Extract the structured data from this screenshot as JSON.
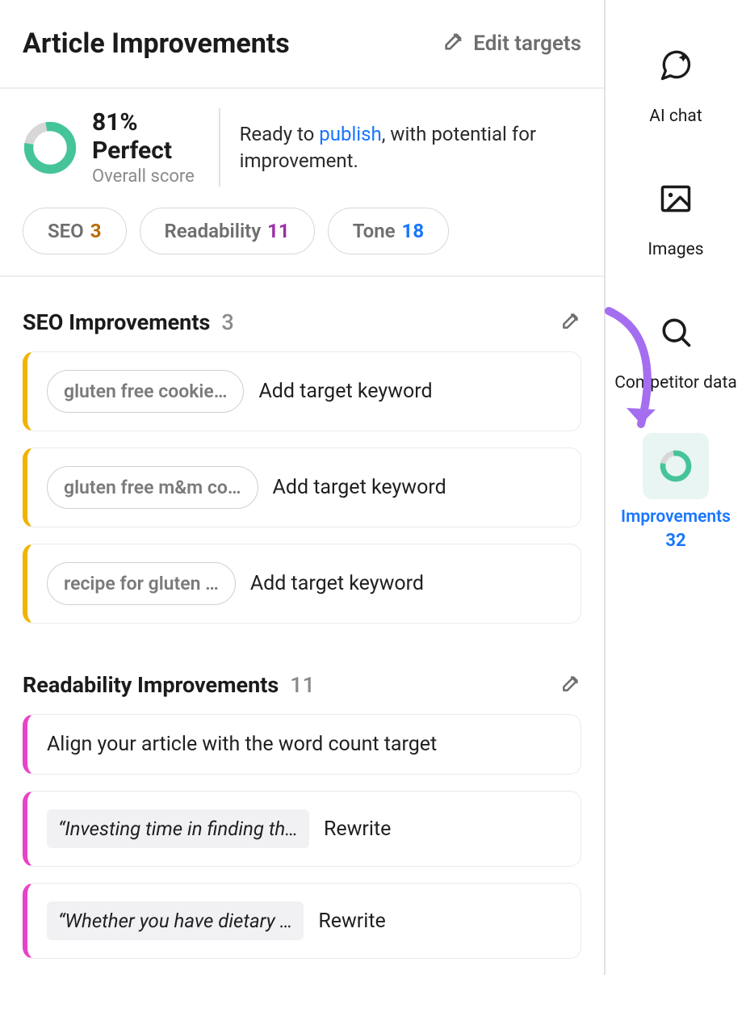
{
  "header": {
    "title": "Article Improvements",
    "edit_targets": "Edit targets"
  },
  "score": {
    "value": "81% Perfect",
    "subtitle": "Overall score",
    "desc_prefix": "Ready to ",
    "desc_link": "publish",
    "desc_suffix": ", with potential for improvement.",
    "percent": 81
  },
  "chips": {
    "seo_label": "SEO",
    "seo_count": "3",
    "read_label": "Readability",
    "read_count": "11",
    "tone_label": "Tone",
    "tone_count": "18"
  },
  "seo_section": {
    "title": "SEO Improvements",
    "count": "3",
    "items": [
      {
        "keyword": "gluten free cookie…",
        "action": "Add target keyword"
      },
      {
        "keyword": "gluten free m&m co…",
        "action": "Add target keyword"
      },
      {
        "keyword": "recipe for gluten …",
        "action": "Add target keyword"
      }
    ]
  },
  "readability_section": {
    "title": "Readability Improvements",
    "count": "11",
    "items": [
      {
        "text": "Align your article with the word count target"
      },
      {
        "quote": "“Investing time in finding th…",
        "action": "Rewrite"
      },
      {
        "quote": "“Whether you have dietary …",
        "action": "Rewrite"
      }
    ]
  },
  "sidebar": {
    "ai_chat": "AI chat",
    "images": "Images",
    "competitor": "Competitor data",
    "improvements": "Improvements",
    "improvements_count": "32"
  },
  "colors": {
    "donut_green": "#45c49a",
    "donut_bg": "#d7d7d7",
    "arrow": "#a56ef1"
  }
}
